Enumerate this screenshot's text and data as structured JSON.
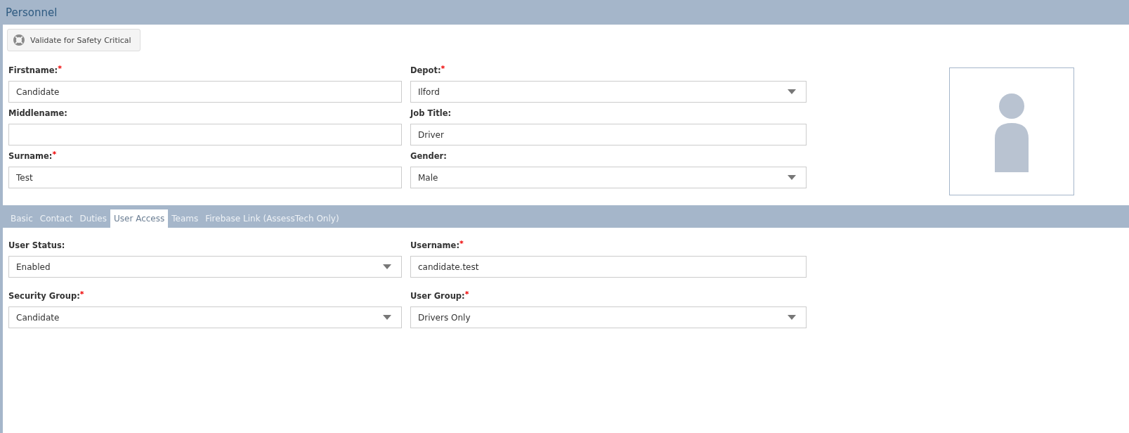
{
  "window": {
    "title": "Personnel"
  },
  "toolbar": {
    "button": "Validate for Safety Critical"
  },
  "details": [
    {
      "label": "Firstname:",
      "required_mark": "*",
      "kind": "text",
      "value": "Candidate"
    },
    {
      "label": "Depot:",
      "required_mark": "*",
      "kind": "select",
      "value": "Ilford"
    },
    {
      "label": "Middlename:",
      "kind": "text"
    },
    {
      "label": "Job Title:",
      "kind": "text",
      "value": "Driver"
    },
    {
      "label": "Surname:",
      "required_mark": "*",
      "kind": "text",
      "value": "Test"
    },
    {
      "label": "Gender:",
      "kind": "select",
      "value": "Male"
    }
  ],
  "tabs": [
    {
      "label": "Basic",
      "selected": false
    },
    {
      "label": "Contact",
      "selected": false
    },
    {
      "label": "Duties",
      "selected": false
    },
    {
      "label": "User Access",
      "selected": true
    },
    {
      "label": "Teams",
      "selected": false
    },
    {
      "label": "Firebase Link (AssessTech Only)",
      "selected": false
    }
  ],
  "user_access": [
    {
      "label": "User Status:",
      "kind": "select",
      "value": "Enabled"
    },
    {
      "label": "Username:",
      "required_mark": "*",
      "kind": "text",
      "value": "candidate.test"
    },
    {
      "label": "Security Group:",
      "required_mark": "*",
      "kind": "select",
      "value": "Candidate"
    },
    {
      "label": "User Group:",
      "required_mark": "*",
      "kind": "select",
      "value": "Drivers Only"
    }
  ]
}
